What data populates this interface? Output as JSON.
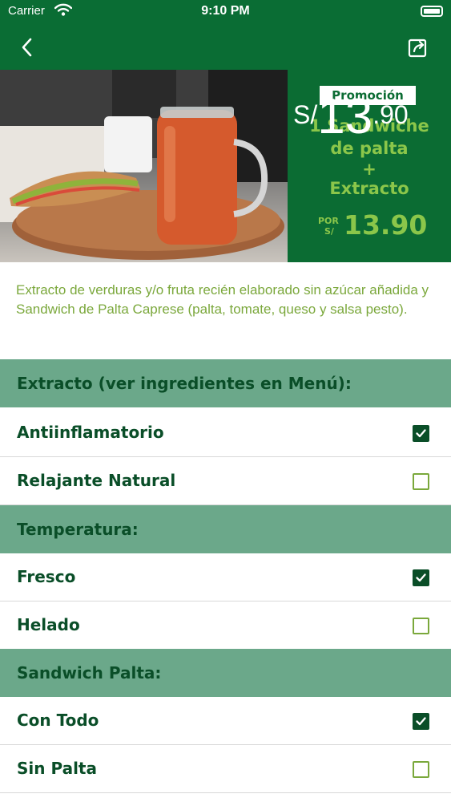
{
  "status_bar": {
    "carrier": "Carrier",
    "time": "9:10 PM"
  },
  "nav": {
    "back_icon": "chevron-left-icon",
    "share_icon": "share-icon"
  },
  "promo": {
    "tag": "Promoción",
    "line1": "1 Sandwiche",
    "line2": "de palta",
    "line3": "+",
    "line4": "Extracto",
    "por_top": "POR",
    "por_bottom": "S/",
    "promo_price": "13.90"
  },
  "price": {
    "currency": "S/",
    "integer": "13",
    "decimal": ".90"
  },
  "description": "Extracto de verduras y/o fruta recién elaborado sin azúcar añadida y Sandwich de Palta Caprese (palta, tomate, queso y salsa pesto).",
  "sections": [
    {
      "title": "Extracto (ver ingredientes en Menú):",
      "options": [
        {
          "label": "Antiinflamatorio",
          "checked": true
        },
        {
          "label": "Relajante Natural",
          "checked": false
        }
      ]
    },
    {
      "title": "Temperatura:",
      "options": [
        {
          "label": "Fresco",
          "checked": true
        },
        {
          "label": "Helado",
          "checked": false
        }
      ]
    },
    {
      "title": "Sandwich Palta:",
      "options": [
        {
          "label": "Con Todo",
          "checked": true
        },
        {
          "label": "Sin Palta",
          "checked": false
        }
      ]
    }
  ],
  "colors": {
    "brand_green": "#0a6d34",
    "section_bg": "#6ba88a",
    "text_dark_green": "#0a4e28",
    "accent_light_green": "#8bc64a"
  }
}
